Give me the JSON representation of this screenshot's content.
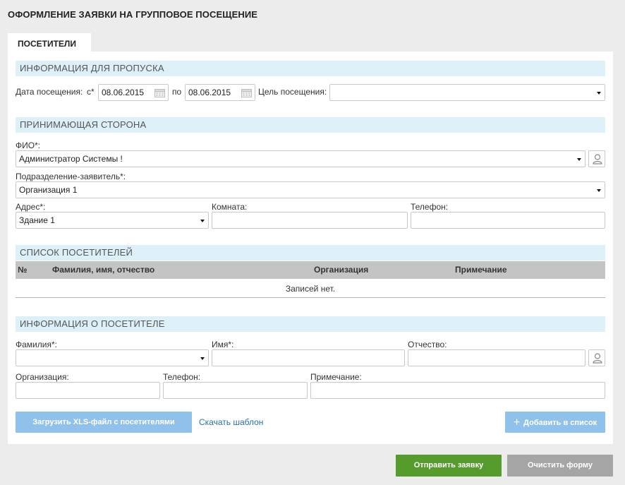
{
  "page_title": "ОФОРМЛЕНИЕ ЗАЯВКИ НА ГРУППОВОЕ ПОСЕЩЕНИЕ",
  "tab_label": "ПОСЕТИТЕЛИ",
  "pass_info": {
    "section_title": "ИНФОРМАЦИЯ ДЛЯ ПРОПУСКА",
    "visit_date_label": "Дата посещения:",
    "from_label": "с*",
    "from_value": "08.06.2015",
    "to_label": "по",
    "to_value": "08.06.2015",
    "purpose_label": "Цель посещения:",
    "purpose_value": ""
  },
  "host": {
    "section_title": "ПРИНИМАЮЩАЯ СТОРОНА",
    "fio_label": "ФИО*:",
    "fio_value": "Администратор Системы !",
    "dept_label": "Подразделение-заявитель*:",
    "dept_value": "Организация 1",
    "address_label": "Адрес*:",
    "address_value": "Здание 1",
    "room_label": "Комната:",
    "room_value": "",
    "phone_label": "Телефон:",
    "phone_value": ""
  },
  "visitors_list": {
    "section_title": "СПИСОК ПОСЕТИТЕЛЕЙ",
    "columns": [
      "№",
      "Фамилия, имя, отчество",
      "Организация",
      "Примечание"
    ],
    "empty_text": "Записей нет."
  },
  "visitor_info": {
    "section_title": "ИНФОРМАЦИЯ О ПОСЕТИТЕЛЕ",
    "lastname_label": "Фамилия*:",
    "firstname_label": "Имя*:",
    "patronymic_label": "Отчество:",
    "org_label": "Организация:",
    "phone_label": "Телефон:",
    "note_label": "Примечание:"
  },
  "actions": {
    "upload_label": "Загрузить XLS-файл с посетителями",
    "template_link": "Скачать шаблон",
    "add_label": "Добавить в список",
    "send_label": "Отправить заявку",
    "clear_label": "Очистить форму"
  },
  "colors": {
    "section_bg": "#ddf0f7",
    "primary_button": "#8fc1ea",
    "submit_button": "#559c2c",
    "clear_button": "#a5a5a5",
    "link": "#2a6ea8"
  }
}
